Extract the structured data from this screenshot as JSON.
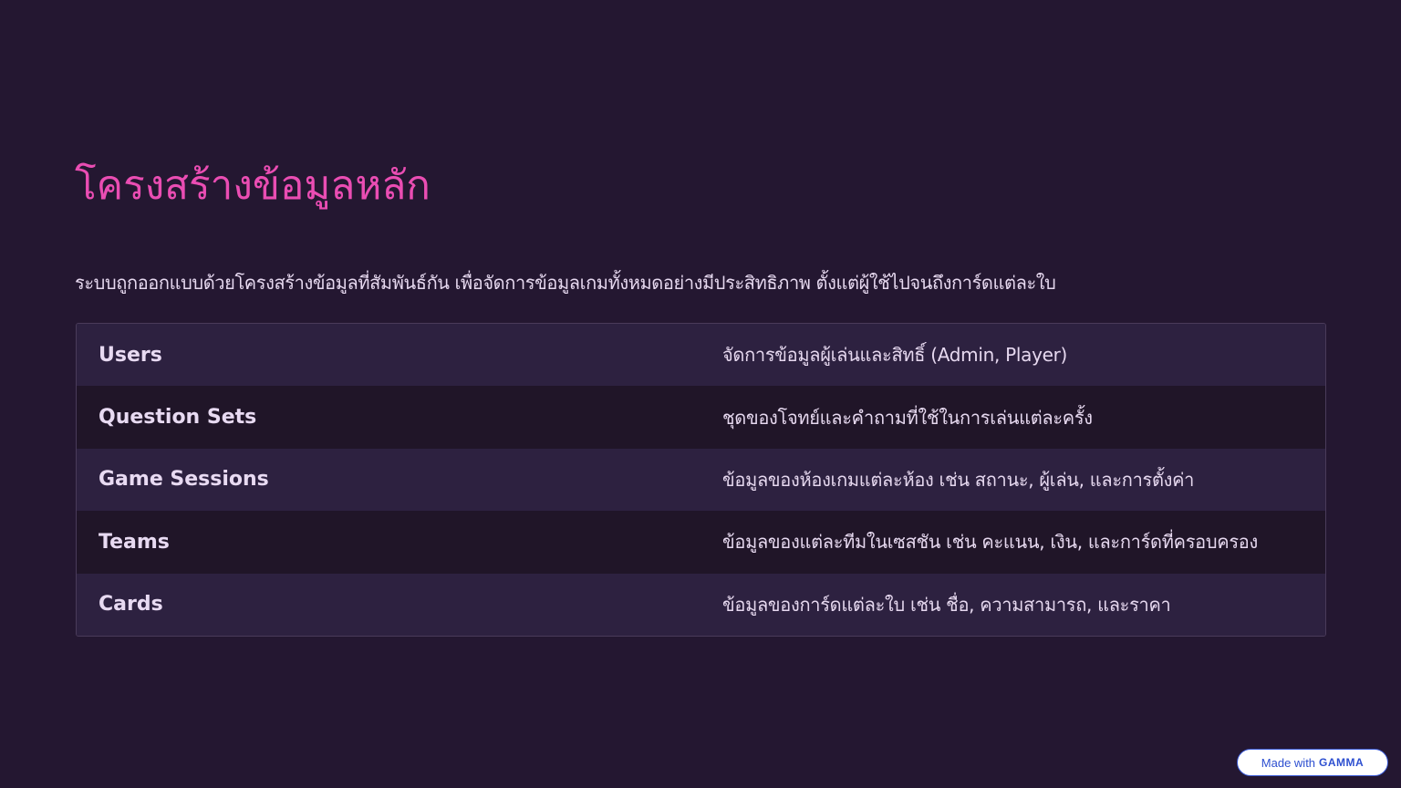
{
  "slide": {
    "title": "โครงสร้างข้อมูลหลัก",
    "subtitle": "ระบบถูกออกแบบด้วยโครงสร้างข้อมูลที่สัมพันธ์กัน เพื่อจัดการข้อมูลเกมทั้งหมดอย่างมีประสิทธิภาพ ตั้งแต่ผู้ใช้ไปจนถึงการ์ดแต่ละใบ"
  },
  "table": {
    "rows": [
      {
        "name": "Users",
        "description": "จัดการข้อมูลผู้เล่นและสิทธิ์ (Admin, Player)"
      },
      {
        "name": "Question Sets",
        "description": "ชุดของโจทย์และคำถามที่ใช้ในการเล่นแต่ละครั้ง"
      },
      {
        "name": "Game Sessions",
        "description": "ข้อมูลของห้องเกมแต่ละห้อง เช่น สถานะ, ผู้เล่น, และการตั้งค่า"
      },
      {
        "name": "Teams",
        "description": "ข้อมูลของแต่ละทีมในเซสชัน เช่น คะแนน, เงิน, และการ์ดที่ครอบครอง"
      },
      {
        "name": "Cards",
        "description": "ข้อมูลของการ์ดแต่ละใบ เช่น ชื่อ, ความสามารถ, และราคา"
      }
    ]
  },
  "badge": {
    "prefix": "Made with",
    "brand": "GAMMA"
  },
  "colors": {
    "background": "#241731",
    "title": "#ea4db3",
    "row_odd": "#2d2140",
    "row_even": "#201528",
    "badge_text": "#2d4fd0"
  }
}
